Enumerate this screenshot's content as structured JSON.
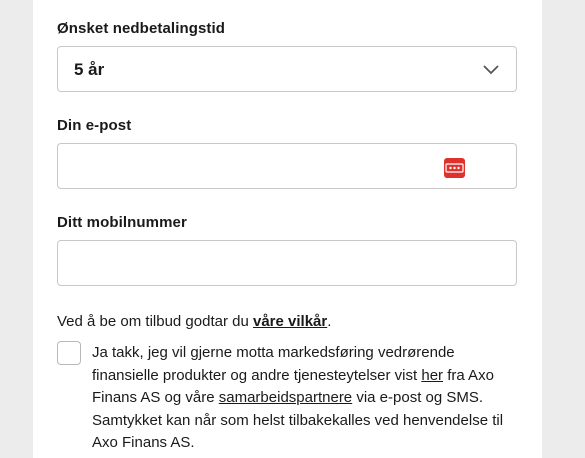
{
  "repayment": {
    "label": "Ønsket nedbetalingstid",
    "selected": "5 år"
  },
  "email": {
    "label": "Din e-post",
    "value": "",
    "password_manager_icon": "password-manager-icon"
  },
  "phone": {
    "label": "Ditt mobilnummer",
    "value": ""
  },
  "terms": {
    "prefix": "Ved å be om tilbud godtar du ",
    "link": "våre vilkår",
    "suffix": "."
  },
  "consent": {
    "checked": false,
    "text_1": "Ja takk, jeg vil gjerne motta markedsføring vedrørende finansielle produkter og andre tjenesteytelser vist ",
    "link_1": "her",
    "text_2": " fra Axo Finans AS og våre ",
    "link_2": "samarbeidspartnere",
    "text_3": " via e-post og SMS. Samtykket kan når som helst tilbakekalles ved henvendelse til Axo Finans AS."
  },
  "colors": {
    "page_bg": "#ececec",
    "card_bg": "#ffffff",
    "border": "#c8c8c8",
    "icon_red": "#e0322c"
  }
}
